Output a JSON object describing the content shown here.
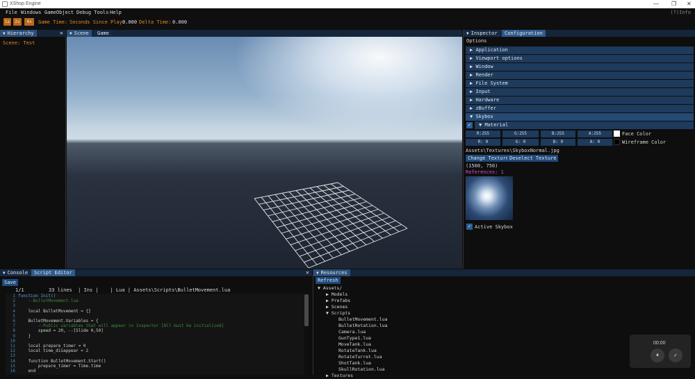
{
  "titlebar": {
    "title": "XShop Engine",
    "minimize": "—",
    "maximize": "❐",
    "close": "✕"
  },
  "menubar": {
    "items": [
      "File",
      "Windows",
      "GameObject",
      "Debug Tools",
      "Help"
    ],
    "help_info": "(?)Info"
  },
  "toolbar": {
    "buttons": [
      "1x",
      "2x",
      "4x"
    ],
    "game_time_label": "Game Time:",
    "seconds_label": "Seconds Since Play:",
    "seconds_value": "0.000",
    "delta_label": "Delta Time:",
    "delta_value": "0.000"
  },
  "hierarchy": {
    "tab": "Hierarchy",
    "scene_label": "Scene: Test"
  },
  "scene": {
    "tabs": [
      "Scene",
      "Game"
    ]
  },
  "inspector": {
    "tabs": [
      "Inspector",
      "Configuration"
    ],
    "options_label": "Options",
    "sections": [
      "Application",
      "Viewport options",
      "Window",
      "Render",
      "File System",
      "Input",
      "Hardware",
      "zBuffer",
      "Skybox"
    ],
    "material_label": "Material",
    "face_color": {
      "r": "R:255",
      "g": "G:255",
      "b": "B:255",
      "a": "A:255",
      "label": "Face Color"
    },
    "wire_color": {
      "r": "R:  0",
      "g": "G:  0",
      "b": "B:  0",
      "a": "A:  0",
      "label": "Wireframe Color"
    },
    "texture_path": "Assets\\Textures\\SkyboxNormal.jpg",
    "change_texture": "Change Texture",
    "deselect_texture": "Deselect Texture",
    "texture_size": "(1500, 750)",
    "references": "References: 1",
    "active_skybox": "Active Skybox",
    "colors": {
      "face": "#ffffff",
      "wire": "#000000"
    }
  },
  "console": {
    "tabs": [
      "Console",
      "Script Editor"
    ],
    "save": "Save",
    "status_pos": "1/1",
    "status_rest": "33 lines  | Ins |    | Lua | Assets\\Scripts\\BulletMovement.lua",
    "lines": [
      {
        "n": "1",
        "t": "function Init()",
        "c": "#5aa0d8"
      },
      {
        "n": "2",
        "t": "    --BulletMovement.lua",
        "c": "#3f8a3f"
      },
      {
        "n": "3",
        "t": "",
        "c": "#d8d8d8"
      },
      {
        "n": "4",
        "t": "    local BulletMovement = {}",
        "c": "#cfcfcf"
      },
      {
        "n": "5",
        "t": "",
        "c": "#d8d8d8"
      },
      {
        "n": "6",
        "t": "    BulletMovement.Variables = {",
        "c": "#cfcfcf"
      },
      {
        "n": "7",
        "t": "        --Public variables that will appear in Inspector [All must be initialized]",
        "c": "#3f8a3f"
      },
      {
        "n": "8",
        "t": "        speed = 20, --[Slide 0,50]",
        "c": "#cfcfcf"
      },
      {
        "n": "9",
        "t": "    }",
        "c": "#cfcfcf"
      },
      {
        "n": "10",
        "t": "",
        "c": "#d8d8d8"
      },
      {
        "n": "11",
        "t": "    local prepare_timer = 0",
        "c": "#cfcfcf"
      },
      {
        "n": "12",
        "t": "    local time_disappear = 2",
        "c": "#cfcfcf"
      },
      {
        "n": "13",
        "t": "",
        "c": "#d8d8d8"
      },
      {
        "n": "14",
        "t": "    function BulletMovement.Start()",
        "c": "#cfcfcf"
      },
      {
        "n": "15",
        "t": "        prepare_timer = Time.time",
        "c": "#cfcfcf"
      },
      {
        "n": "16",
        "t": "    end",
        "c": "#cfcfcf"
      }
    ]
  },
  "resources": {
    "tab": "Resources",
    "refresh": "Refresh",
    "root": "Assets/",
    "folders": [
      "Models",
      "Prefabs",
      "Scenes",
      "Scripts"
    ],
    "scripts": [
      "BulletMovement.lua",
      "BulletRotation.lua",
      "Camera.lua",
      "GunType1.lua",
      "MoveTank.lua",
      "RotateTank.lua",
      "RotateTurret.lua",
      "ShotTank.lua",
      "SkullRotation.lua"
    ],
    "last_folder": "Textures"
  },
  "media": {
    "time": "00:00",
    "pause": "⏸",
    "confirm": "✓"
  },
  "icons": [
    "app-icon",
    "caret-down-icon",
    "close-icon",
    "caret-right-icon",
    "check-icon"
  ]
}
